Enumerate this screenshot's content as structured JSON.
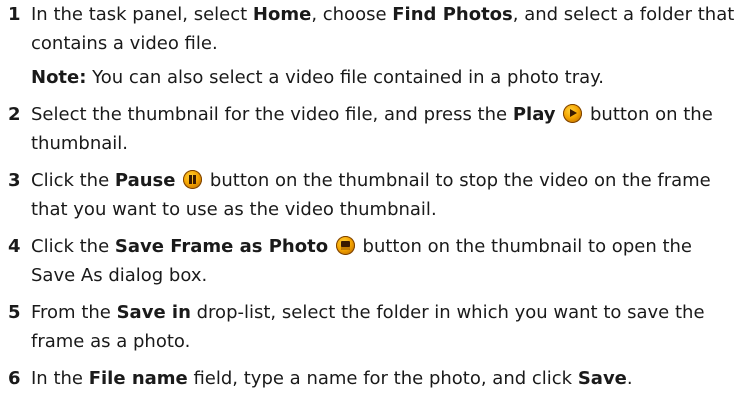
{
  "steps": [
    {
      "number": "1",
      "t1": "In the task panel, select ",
      "b1": "Home",
      "t2": ", choose ",
      "b2": "Find Photos",
      "t3": ", and select a folder that contains a video file.",
      "note_label": "Note:",
      "note_text": " You can also select a video file contained in a photo tray."
    },
    {
      "number": "2",
      "t1": "Select the thumbnail for the video file, and press the ",
      "b1": "Play",
      "icon": "play-icon",
      "t2": " button on the thumbnail."
    },
    {
      "number": "3",
      "t1": "Click the ",
      "b1": "Pause",
      "icon": "pause-icon",
      "t2": " button on the thumbnail to stop the video on the frame that you want to use as the video thumbnail."
    },
    {
      "number": "4",
      "t1": "Click the ",
      "b1": "Save Frame as Photo",
      "icon": "save-frame-icon",
      "t2": " button on the thumbnail to open the Save As dialog box."
    },
    {
      "number": "5",
      "t1": "From the ",
      "b1": "Save in",
      "t2": " drop-list, select the folder in which you want to save the frame as a photo."
    },
    {
      "number": "6",
      "t1": "In the ",
      "b1": "File name",
      "t2": " field, type a name for the photo, and click ",
      "b2": "Save",
      "t3": "."
    }
  ],
  "colors": {
    "text": "#1a1a1a",
    "icon_fill": "#f4a300"
  }
}
